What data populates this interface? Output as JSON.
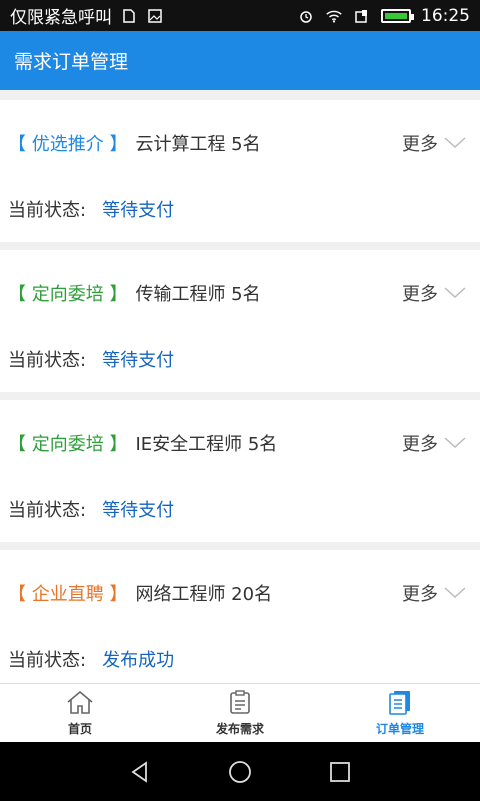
{
  "statusbar": {
    "left_text": "仅限紧急呼叫",
    "time": "16:25",
    "battery_level": 1.0,
    "icons": [
      "sim-icon",
      "image-icon",
      "alarm-icon",
      "wifi-icon",
      "signal-icon",
      "battery-icon"
    ]
  },
  "header": {
    "title": "需求订单管理"
  },
  "colors": {
    "header_bg": "#1e88e5",
    "tag_blue": "#1e88e5",
    "tag_green": "#2e9e3a",
    "tag_orange": "#e8752a",
    "status_blue": "#1565c0",
    "active_tab": "#1e88e5"
  },
  "orders": [
    {
      "tag": "【 优选推介 】",
      "tag_color": "#1e88e5",
      "title": "云计算工程 5名",
      "more_label": "更多",
      "status_label": "当前状态:",
      "status_value": "等待支付"
    },
    {
      "tag": "【 定向委培 】",
      "tag_color": "#2e9e3a",
      "title": "传输工程师 5名",
      "more_label": "更多",
      "status_label": "当前状态:",
      "status_value": "等待支付"
    },
    {
      "tag": "【 定向委培 】",
      "tag_color": "#2e9e3a",
      "title": "IE安全工程师 5名",
      "more_label": "更多",
      "status_label": "当前状态:",
      "status_value": "等待支付"
    },
    {
      "tag": "【 企业直聘 】",
      "tag_color": "#e8752a",
      "title": "网络工程师 20名",
      "more_label": "更多",
      "status_label": "当前状态:",
      "status_value": "发布成功"
    }
  ],
  "tabs": [
    {
      "label": "首页",
      "icon": "home-icon",
      "active": false
    },
    {
      "label": "发布需求",
      "icon": "clipboard-icon",
      "active": false
    },
    {
      "label": "订单管理",
      "icon": "order-list-icon",
      "active": true
    }
  ],
  "navbar": {
    "icons": [
      "back-icon",
      "home-circle-icon",
      "recents-icon"
    ]
  }
}
